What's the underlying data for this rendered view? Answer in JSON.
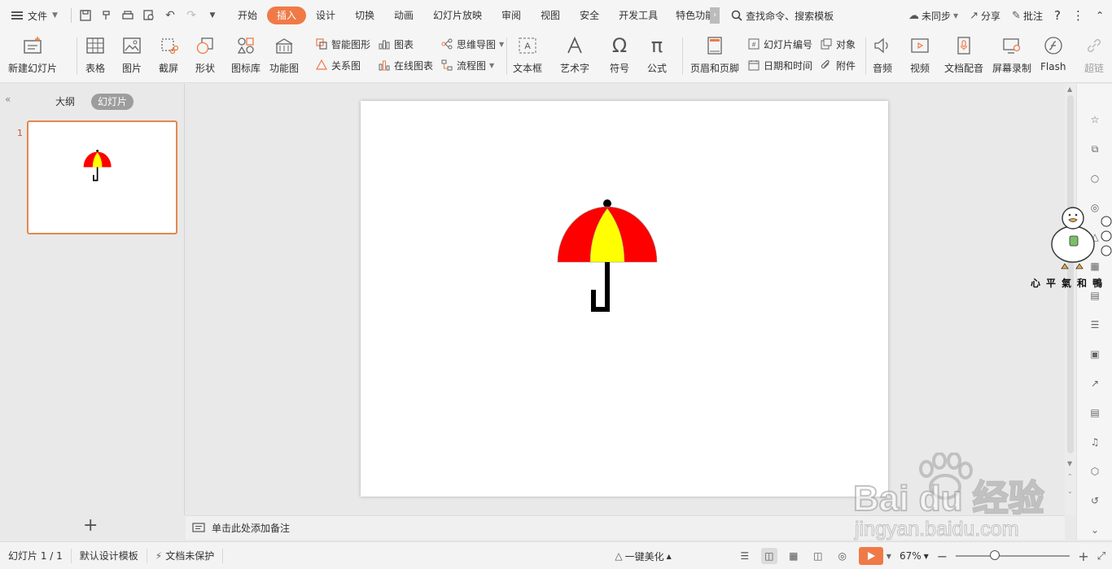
{
  "topbar": {
    "file_label": "文件",
    "tabs": [
      {
        "label": "开始"
      },
      {
        "label": "插入"
      },
      {
        "label": "设计"
      },
      {
        "label": "切换"
      },
      {
        "label": "动画"
      },
      {
        "label": "幻灯片放映"
      },
      {
        "label": "审阅"
      },
      {
        "label": "视图"
      },
      {
        "label": "安全"
      },
      {
        "label": "开发工具"
      },
      {
        "label": "特色功能"
      }
    ],
    "active_tab": "插入",
    "search_label": "查找命令、搜索模板",
    "sync_label": "未同步",
    "share_label": "分享",
    "comment_label": "批注",
    "help_label": "?"
  },
  "ribbon": {
    "new_slide": "新建幻灯片",
    "table": "表格",
    "picture": "图片",
    "screenshot": "截屏",
    "shape": "形状",
    "icon_lib": "图标库",
    "func_chart": "功能图",
    "smart_art": "智能图形",
    "chart": "图表",
    "mind_map": "思维导图",
    "relation": "关系图",
    "online_chart": "在线图表",
    "flowchart": "流程图",
    "textbox": "文本框",
    "wordart": "艺术字",
    "symbol": "符号",
    "formula": "公式",
    "header_footer": "页眉和页脚",
    "slide_number": "幻灯片编号",
    "object": "对象",
    "datetime": "日期和时间",
    "attachment": "附件",
    "audio": "音频",
    "video": "视频",
    "doc_audio": "文档配音",
    "screen_record": "屏幕录制",
    "flash": "Flash",
    "hyperlink": "超链"
  },
  "left_panel": {
    "outline_tab": "大纲",
    "slides_tab": "幻灯片",
    "slide_index": "1",
    "add_slide": "+"
  },
  "notes": {
    "placeholder": "单击此处添加备注"
  },
  "status": {
    "slide_pos": "幻灯片 1 / 1",
    "template": "默认设计模板",
    "protect": "文档未保护",
    "beautify": "一键美化",
    "zoom": "67%",
    "zoom_level": 0.33
  },
  "mascot": {
    "caption": "心平氣和鴨"
  },
  "watermark": {
    "brand": "Bai du 经验",
    "url": "jingyan.baidu.com"
  },
  "colors": {
    "accent": "#f07a47",
    "umbrella_red": "#ff0000",
    "umbrella_yellow": "#ffff00"
  }
}
